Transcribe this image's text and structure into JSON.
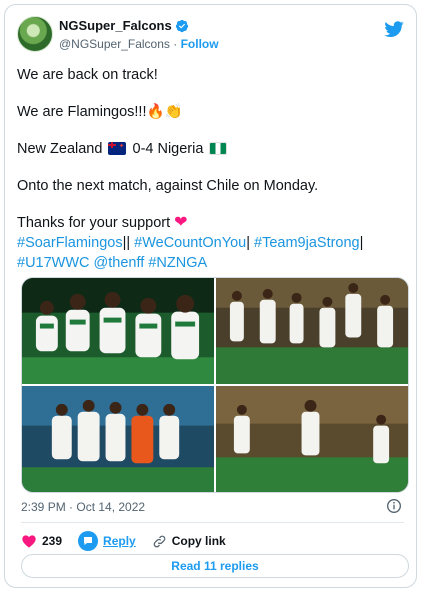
{
  "tweet": {
    "author_name": "NGSuper_Falcons",
    "handle": "@NGSuper_Falcons",
    "separator": "·",
    "follow_label": "Follow",
    "lines": {
      "l1": "We are back on track!",
      "l2": "We are Flamingos!!!🔥👏",
      "l3_a": "New Zealand",
      "l3_b": "0-4 Nigeria",
      "l4": "Onto the next match, against Chile on Monday.",
      "l5": "Thanks for your support",
      "heart": "❤",
      "hashtags": {
        "h1": "#SoarFlamingos",
        "sep1": "||",
        "h2": "#WeCountOnYou",
        "sep2": "|",
        "h3": "#Team9jaStrong",
        "sep3": "|",
        "h4": "#U17WWC",
        "h5": "@thenff",
        "h6": "#NZNGA"
      }
    },
    "timestamp": "2:39 PM · Oct 14, 2022",
    "like_count": "239",
    "reply_label": "Reply",
    "copy_link_label": "Copy link",
    "read_replies_label": "Read 11 replies"
  },
  "icons": {
    "avatar": "team-avatar",
    "verified": "verified-badge-icon",
    "logo": "twitter-bird-icon",
    "info": "info-icon",
    "like": "heart-icon",
    "reply": "reply-icon",
    "copy": "link-icon"
  },
  "colors": {
    "accent": "#1d9bf0",
    "like": "#f91880",
    "text": "#0f1419",
    "muted": "#536471",
    "nigeria_green": "#008751"
  }
}
